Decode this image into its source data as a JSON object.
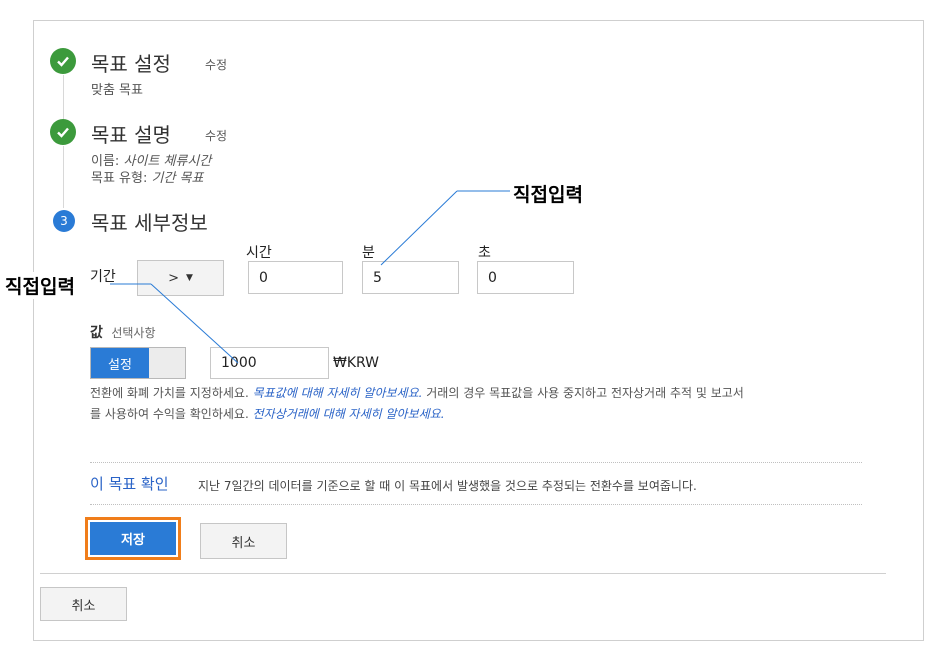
{
  "steps": [
    {
      "title": "목표 설정",
      "edit": "수정",
      "detail": "맞춤 목표"
    },
    {
      "title": "목표 설명",
      "edit": "수정",
      "name_label": "이름:",
      "name_value": "사이트 체류시간",
      "type_label": "목표 유형:",
      "type_value": "기간 목표"
    },
    {
      "number": "3",
      "title": "목표 세부정보"
    }
  ],
  "duration": {
    "label": "기간",
    "operator": ">",
    "hours_label": "시간",
    "hours_value": "0",
    "minutes_label": "분",
    "minutes_value": "5",
    "seconds_label": "초",
    "seconds_value": "0"
  },
  "value": {
    "label": "값",
    "optional": "선택사항",
    "toggle_on": "설정",
    "amount": "1000",
    "currency": "₩KRW",
    "note_part1": "전환에 화폐 가치를 지정하세요.",
    "note_link1": "목표값에 대해 자세히 알아보세요.",
    "note_part2": "거래의 경우 목표값을 사용 중지하고 전자상거래 추적 및 보고서",
    "note_part3": "를 사용하여 수익을 확인하세요.",
    "note_link2": "전자상거래에 대해 자세히 알아보세요."
  },
  "verify": {
    "link": "이 목표 확인",
    "text": "지난 7일간의 데이터를 기준으로 할 때 이 목표에서 발생했을 것으로 추정되는 전환수를 보여줍니다."
  },
  "actions": {
    "save": "저장",
    "cancel": "취소",
    "outer_cancel": "취소"
  },
  "callouts": {
    "top": "직접입력",
    "left": "직접입력"
  },
  "colors": {
    "check": "#3c9a3c",
    "primary": "#2a7bd6",
    "highlight": "#f07d1a",
    "link": "#2a63c7"
  }
}
